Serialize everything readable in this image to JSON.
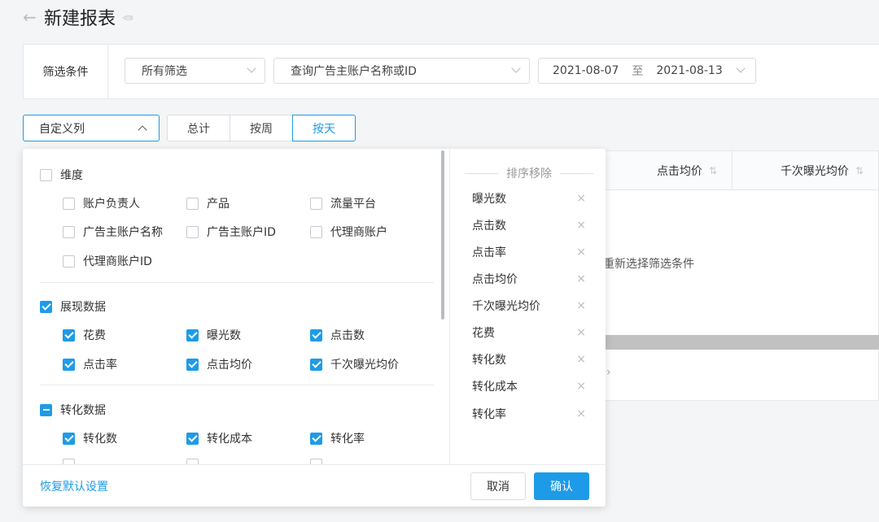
{
  "header": {
    "title": "新建报表",
    "back_icon": "arrow-left-icon",
    "edit_icon": "pencil-icon"
  },
  "filters": {
    "label": "筛选条件",
    "filter_select": "所有筛选",
    "account_select_placeholder": "查询广告主账户名称或ID",
    "date_start": "2021-08-07",
    "date_sep": "至",
    "date_end": "2021-08-13"
  },
  "toolbar": {
    "custom_columns": "自定义列",
    "tabs": [
      {
        "label": "总计",
        "active": false
      },
      {
        "label": "按周",
        "active": false
      },
      {
        "label": "按天",
        "active": true
      }
    ]
  },
  "table": {
    "headers": [
      "点击均价",
      "千次曝光均价"
    ],
    "empty_text": "重新选择筛选条件",
    "pager_arrow": "›"
  },
  "column_picker": {
    "groups": [
      {
        "label": "维度",
        "state": "unchecked",
        "options": [
          {
            "label": "账户负责人",
            "checked": false
          },
          {
            "label": "产品",
            "checked": false
          },
          {
            "label": "流量平台",
            "checked": false
          },
          {
            "label": "广告主账户名称",
            "checked": false
          },
          {
            "label": "广告主账户ID",
            "checked": false
          },
          {
            "label": "代理商账户",
            "checked": false
          },
          {
            "label": "代理商账户ID",
            "checked": false
          }
        ]
      },
      {
        "label": "展现数据",
        "state": "checked",
        "options": [
          {
            "label": "花费",
            "checked": true
          },
          {
            "label": "曝光数",
            "checked": true
          },
          {
            "label": "点击数",
            "checked": true
          },
          {
            "label": "点击率",
            "checked": true
          },
          {
            "label": "点击均价",
            "checked": true
          },
          {
            "label": "千次曝光均价",
            "checked": true
          }
        ]
      },
      {
        "label": "转化数据",
        "state": "partial",
        "options": [
          {
            "label": "转化数",
            "checked": true
          },
          {
            "label": "转化成本",
            "checked": true
          },
          {
            "label": "转化率",
            "checked": true
          }
        ]
      }
    ],
    "sort_title": "排序移除",
    "sort_items": [
      "曝光数",
      "点击数",
      "点击率",
      "点击均价",
      "千次曝光均价",
      "花费",
      "转化数",
      "转化成本",
      "转化率"
    ],
    "remove_glyph": "×",
    "reset_label": "恢复默认设置",
    "cancel_label": "取消",
    "confirm_label": "确认"
  },
  "colors": {
    "accent": "#1e9be8",
    "background": "#f4f5f7"
  }
}
